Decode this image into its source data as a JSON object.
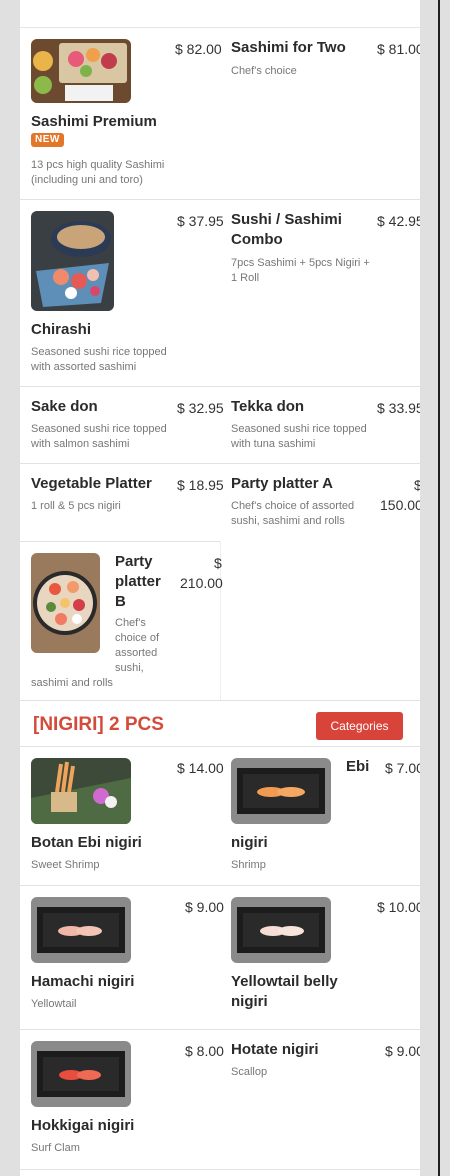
{
  "sections": {
    "nigiri": {
      "title": "[NIGIRI] 2 PCS",
      "categories_button": "Categories"
    }
  },
  "items": {
    "sashimi_premium": {
      "name": "Sashimi Premium",
      "badge": "NEW",
      "desc": "13 pcs high quality Sashimi (including uni and toro)",
      "price": "$ 82.00"
    },
    "sashimi_for_two": {
      "name": "Sashimi for Two",
      "desc": "Chef's choice",
      "price": "$ 81.00"
    },
    "chirashi": {
      "name": "Chirashi",
      "desc": "Seasoned sushi rice topped with assorted sashimi",
      "price": "$ 37.95"
    },
    "sushi_sashimi_combo": {
      "name": "Sushi / Sashimi Combo",
      "desc": "7pcs Sashimi + 5pcs Nigiri + 1 Roll",
      "price": "$ 42.95"
    },
    "sake_don": {
      "name": "Sake don",
      "desc": "Seasoned sushi rice topped with salmon sashimi",
      "price": "$ 32.95"
    },
    "tekka_don": {
      "name": "Tekka don",
      "desc": "Seasoned sushi rice topped with tuna sashimi",
      "price": "$ 33.95"
    },
    "vegetable_platter": {
      "name": "Vegetable Platter",
      "desc": "1 roll & 5 pcs nigiri",
      "price": "$ 18.95"
    },
    "party_platter_a": {
      "name": "Party platter A",
      "desc": "Chef's choice of assorted sushi, sashimi and rolls",
      "price_symbol": "$",
      "price_value": "150.00"
    },
    "party_platter_b": {
      "name_line1": "Party",
      "name_line2": "platter",
      "name_line3": "B",
      "desc_line1": "Chef's",
      "desc_line2": "choice of",
      "desc_line3": "assorted",
      "desc_line4": "sushi,",
      "desc_line5": "sashimi and rolls",
      "price_symbol": "$",
      "price_value": "210.00"
    },
    "botan_ebi": {
      "name": "Botan Ebi nigiri",
      "desc": "Sweet Shrimp",
      "price": "$ 14.00"
    },
    "ebi": {
      "name_part1": "Ebi",
      "name_part2": "nigiri",
      "desc": "Shrimp",
      "price": "$ 7.00"
    },
    "hamachi": {
      "name": "Hamachi nigiri",
      "desc": "Yellowtail",
      "price": "$ 9.00"
    },
    "yellowtail_belly": {
      "name": "Yellowtail belly nigiri",
      "desc": "",
      "price": "$ 10.00"
    },
    "hokkigai": {
      "name": "Hokkigai nigiri",
      "desc": "Surf Clam",
      "price": "$ 8.00"
    },
    "hotate": {
      "name": "Hotate nigiri",
      "desc": "Scallop",
      "price": "$ 9.00"
    }
  },
  "colors": {
    "accent": "#d44b3c",
    "button": "#d9443a",
    "badge": "#e2772b"
  }
}
